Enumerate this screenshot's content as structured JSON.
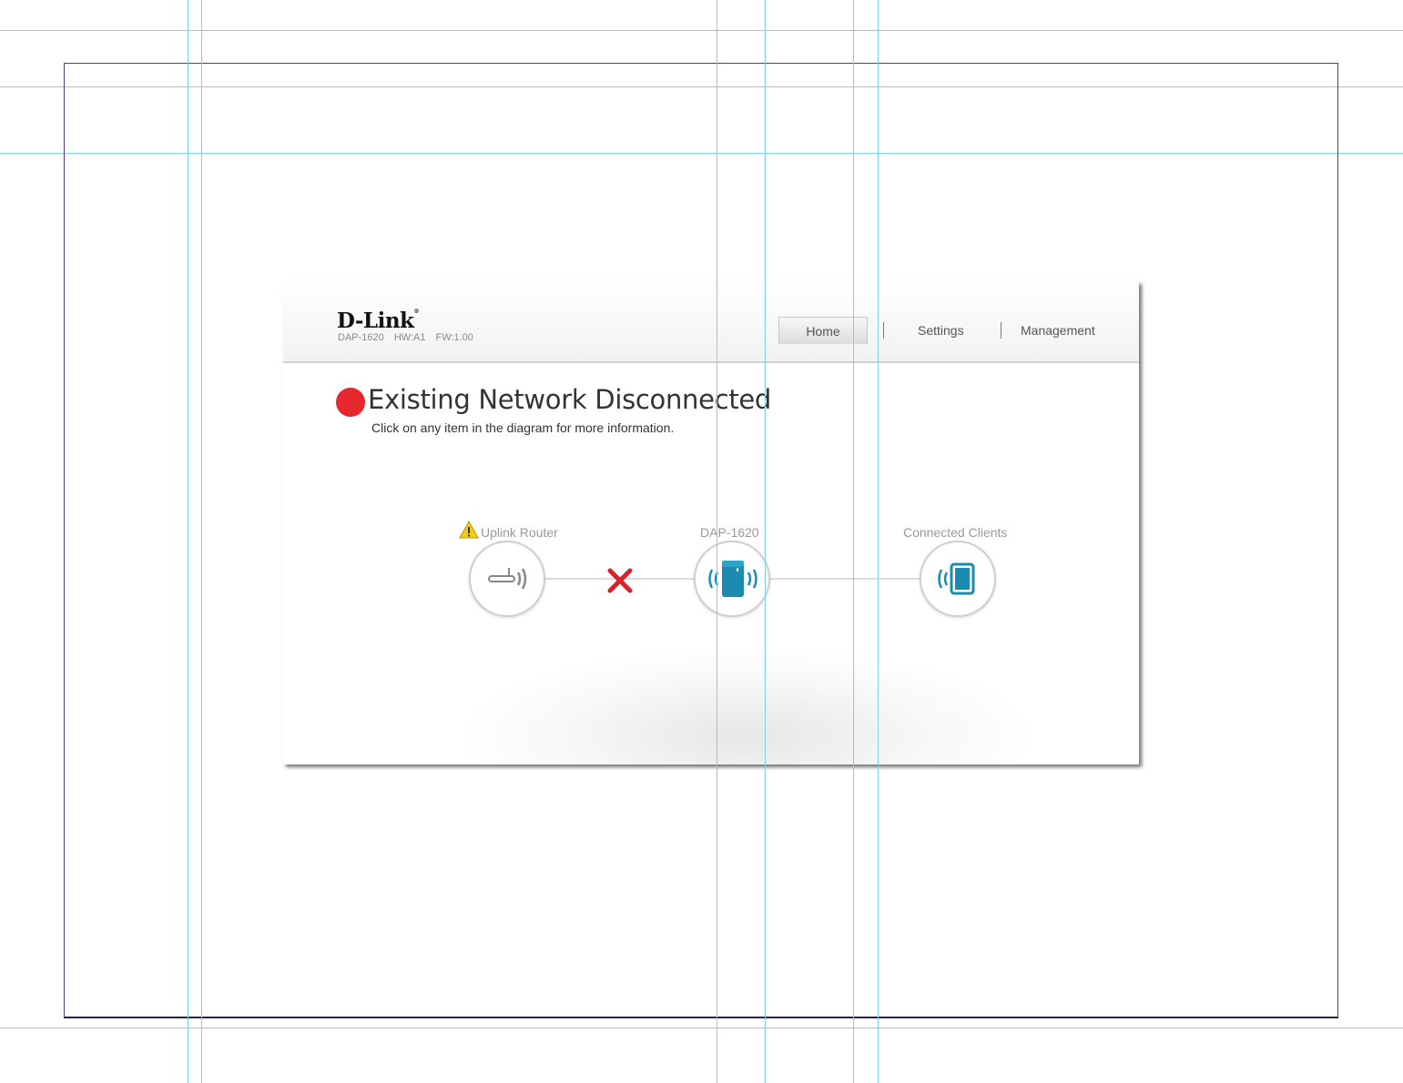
{
  "header": {
    "logo": "D-Link",
    "model": "DAP-1620",
    "hw": "HW:A1",
    "fw": "FW:1.00"
  },
  "nav": {
    "home": "Home",
    "settings": "Settings",
    "management": "Management"
  },
  "status": {
    "title": "Existing Network Disconnected",
    "subtitle": "Click on any item in the diagram for more information.",
    "color": "#e8262d"
  },
  "diagram": {
    "router_label": "Uplink Router",
    "device_label": "DAP-1620",
    "clients_label": "Connected Clients",
    "accent_color": "#1b8bb0",
    "disconnect_color": "#d8222a",
    "warning_color": "#f2cc1b"
  }
}
